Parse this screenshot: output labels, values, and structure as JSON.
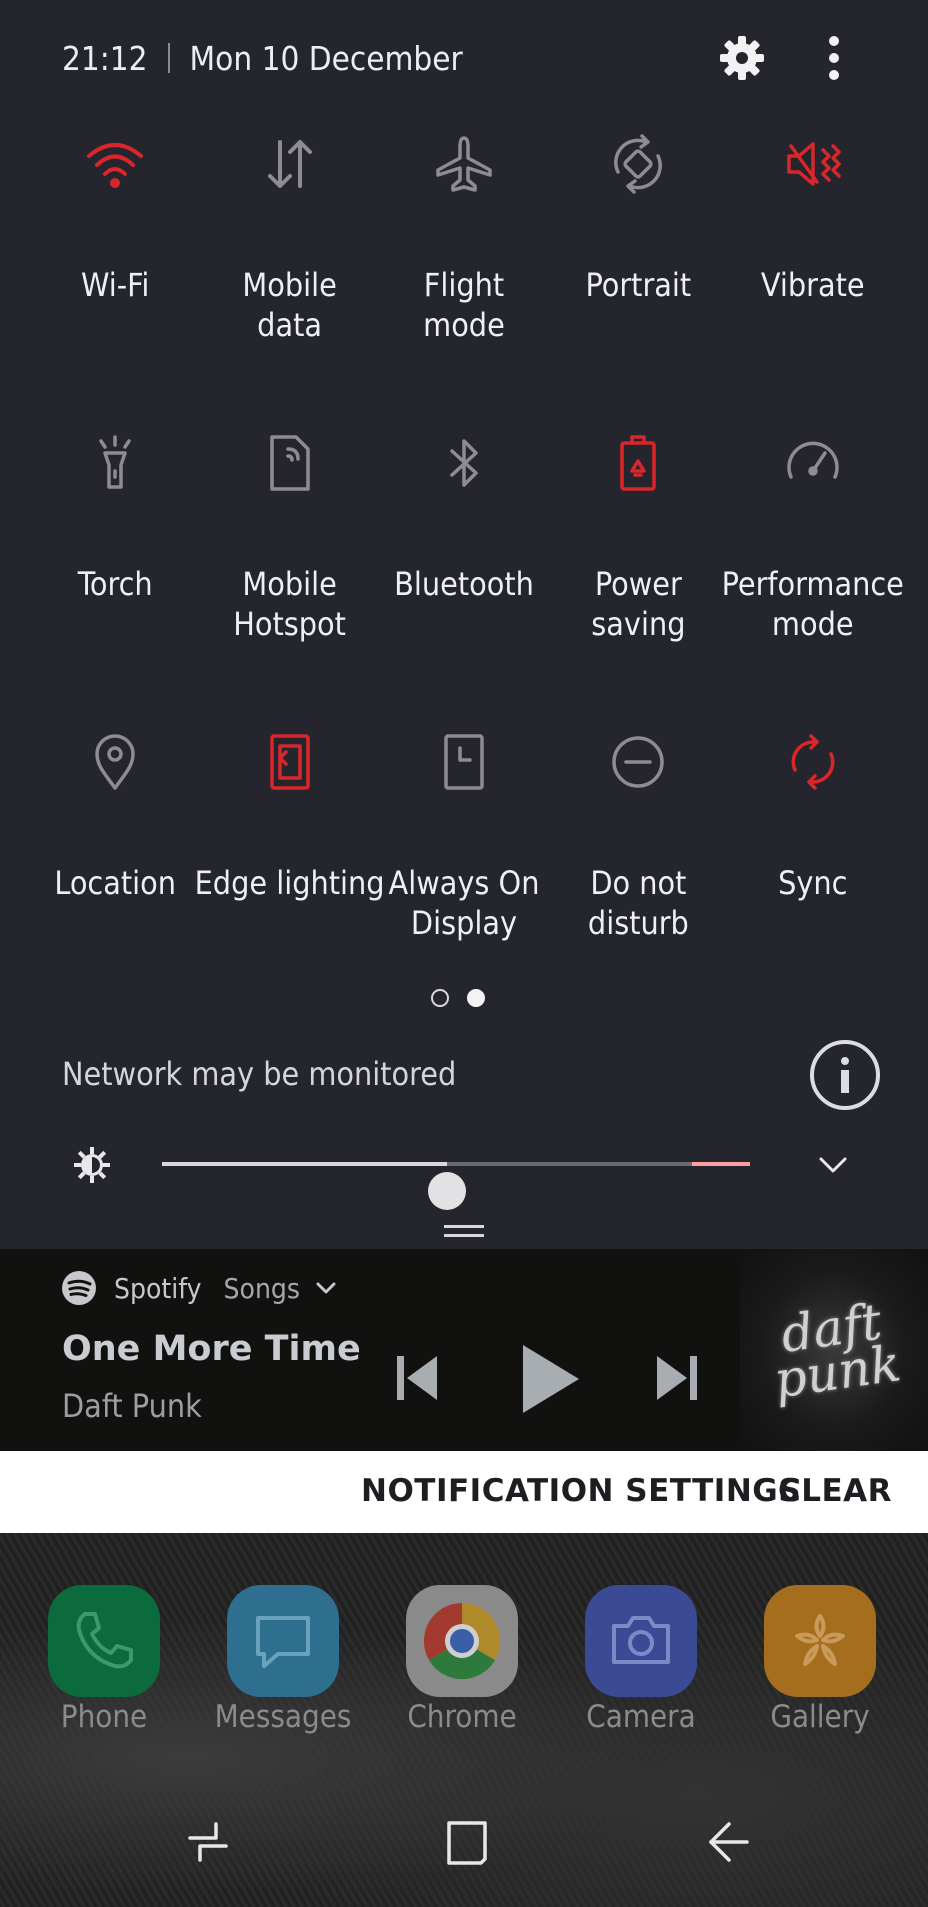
{
  "status": {
    "time": "21:12",
    "date": "Mon 10 December"
  },
  "tiles": [
    {
      "label": "Wi-Fi",
      "icon": "wifi-icon",
      "active": true
    },
    {
      "label": "Mobile\ndata",
      "icon": "mobile-data-icon",
      "active": false
    },
    {
      "label": "Flight\nmode",
      "icon": "airplane-icon",
      "active": false
    },
    {
      "label": "Portrait",
      "icon": "rotation-icon",
      "active": false
    },
    {
      "label": "Vibrate",
      "icon": "vibrate-icon",
      "active": true
    },
    {
      "label": "Torch",
      "icon": "torch-icon",
      "active": false
    },
    {
      "label": "Mobile\nHotspot",
      "icon": "hotspot-icon",
      "active": false
    },
    {
      "label": "Bluetooth",
      "icon": "bluetooth-icon",
      "active": false
    },
    {
      "label": "Power\nsaving",
      "icon": "battery-icon",
      "active": true
    },
    {
      "label": "Performance\nmode",
      "icon": "speedometer-icon",
      "active": false
    },
    {
      "label": "Location",
      "icon": "location-pin-icon",
      "active": false
    },
    {
      "label": "Edge lighting",
      "icon": "edge-lighting-icon",
      "active": true
    },
    {
      "label": "Always On\nDisplay",
      "icon": "clock-screen-icon",
      "active": false
    },
    {
      "label": "Do not\ndisturb",
      "icon": "minus-circle-icon",
      "active": false
    },
    {
      "label": "Sync",
      "icon": "sync-icon",
      "active": true
    }
  ],
  "pages": {
    "count": 2,
    "current": 2
  },
  "network_message": "Network may be monitored",
  "brightness": {
    "level": 0.485
  },
  "media": {
    "app": "Spotify",
    "category": "Songs",
    "title": "One More Time",
    "artist": "Daft Punk",
    "album_art_text": "daft\npunk"
  },
  "notification_bar": {
    "settings_label": "NOTIFICATION SETTINGS",
    "clear_label": "CLEAR"
  },
  "dock": [
    {
      "label": "Phone",
      "icon": "phone-icon",
      "color": "#0c6b3c"
    },
    {
      "label": "Messages",
      "icon": "messages-icon",
      "color": "#2e6f8f"
    },
    {
      "label": "Chrome",
      "icon": "chrome-icon",
      "color": "#8a8a8a"
    },
    {
      "label": "Camera",
      "icon": "camera-icon",
      "color": "#3b4a94"
    },
    {
      "label": "Gallery",
      "icon": "gallery-icon",
      "color": "#a56e1e"
    }
  ],
  "colors": {
    "accent_active": "#d8262b",
    "inactive": "#8c8c92",
    "panel_bg": "#25252d"
  }
}
